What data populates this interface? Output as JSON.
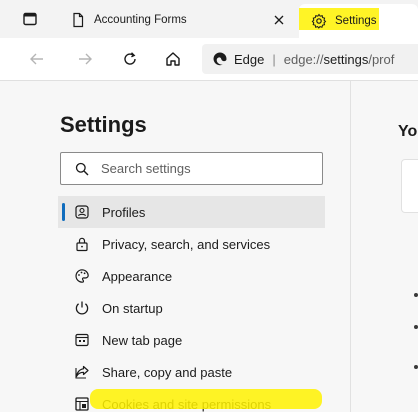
{
  "tabs": [
    {
      "title": "Accounting Forms",
      "icon": "page-icon",
      "active": false
    },
    {
      "title": "Settings",
      "icon": "gear-icon",
      "active": true
    }
  ],
  "address_bar": {
    "site_label": "Edge",
    "separator": "|",
    "url_prefix": "edge://",
    "url_bold": "settings",
    "url_suffix": "/prof"
  },
  "sidebar": {
    "title": "Settings",
    "search_placeholder": "Search settings",
    "items": [
      {
        "label": "Profiles",
        "icon": "profile-icon",
        "selected": true
      },
      {
        "label": "Privacy, search, and services",
        "icon": "lock-icon",
        "selected": false
      },
      {
        "label": "Appearance",
        "icon": "palette-icon",
        "selected": false
      },
      {
        "label": "On startup",
        "icon": "power-icon",
        "selected": false
      },
      {
        "label": "New tab page",
        "icon": "new-tab-icon",
        "selected": false
      },
      {
        "label": "Share, copy and paste",
        "icon": "share-icon",
        "selected": false
      },
      {
        "label": "Cookies and site permissions",
        "icon": "cookies-icon",
        "selected": false
      }
    ]
  },
  "main": {
    "heading_partial": "Yo"
  },
  "colors": {
    "accent": "#0f6cbd",
    "highlight": "#fff200",
    "page_background": "#f7f7f7"
  }
}
